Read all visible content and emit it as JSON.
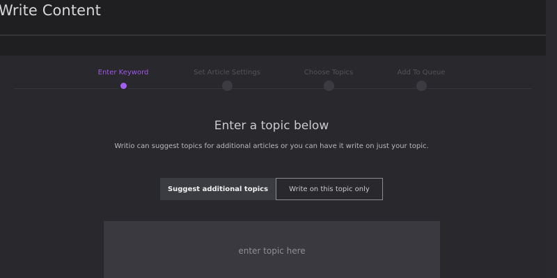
{
  "page": {
    "title": "Write Content"
  },
  "stepper": {
    "steps": [
      {
        "label": "Enter Keyword",
        "active": true
      },
      {
        "label": "Set Article Settings",
        "active": false
      },
      {
        "label": "Choose Topics",
        "active": false
      },
      {
        "label": "Add To Queue",
        "active": false
      }
    ]
  },
  "main": {
    "heading": "Enter a topic below",
    "subtitle": "Writio can suggest topics for additional articles or you can have it write on just your topic."
  },
  "toggle": {
    "options": [
      {
        "label": "Suggest additional topics",
        "selected": true
      },
      {
        "label": "Write on this topic only",
        "selected": false
      }
    ]
  },
  "topic_input": {
    "value": "",
    "placeholder": "enter topic here"
  },
  "colors": {
    "accent": "#a05ff0",
    "background": "#1f1e21",
    "panel": "#29282c"
  }
}
